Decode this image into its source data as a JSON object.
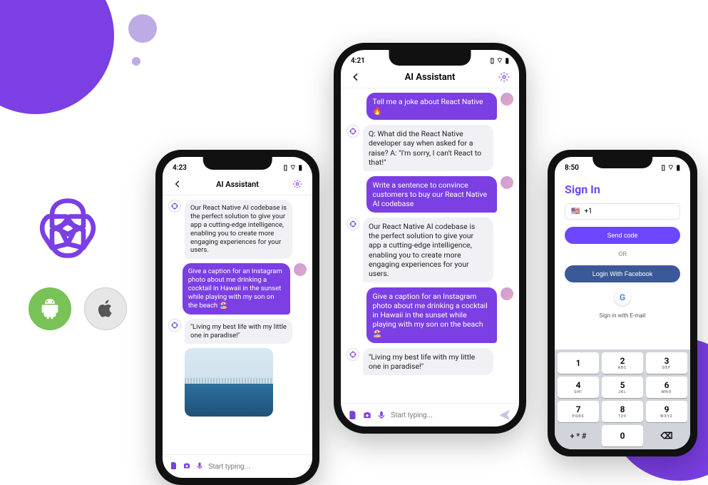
{
  "phones": {
    "chat_small": {
      "time": "4:23",
      "title": "AI Assistant",
      "messages": [
        {
          "role": "ai",
          "text": "Our React Native AI codebase is the perfect solution to give your app a cutting-edge intelligence, enabling you to create more engaging experiences for your users."
        },
        {
          "role": "user",
          "text": "Give a caption for an Instagram photo about me drinking a cocktail in Hawaii in the sunset while playing with my son on the beach 🏖️"
        },
        {
          "role": "ai",
          "text": "\"Living my best life with my little one in paradise!\""
        }
      ],
      "input_placeholder": "Start typing..."
    },
    "chat_big": {
      "time": "4:21",
      "title": "AI Assistant",
      "messages": [
        {
          "role": "user",
          "text": "Tell me a joke about React Native 🔥"
        },
        {
          "role": "ai",
          "text": "Q: What did the React Native developer say when asked for a raise? A: \"I'm sorry, I can't React to that!\""
        },
        {
          "role": "user",
          "text": "Write a sentence to convince customers to buy our React Native AI codebase"
        },
        {
          "role": "ai",
          "text": "Our React Native AI codebase is the perfect solution to give your app a cutting-edge intelligence, enabling you to create more engaging experiences for your users."
        },
        {
          "role": "user",
          "text": "Give a caption for an Instagram photo about me drinking a cocktail in Hawaii in the sunset while playing with my son on the beach 🏖️"
        },
        {
          "role": "ai",
          "text": "\"Living my best life with my little one in paradise!\""
        }
      ],
      "input_placeholder": "Start typing..."
    },
    "signin": {
      "time": "8:50",
      "title": "Sign In",
      "country_prefix": "+1",
      "send_code": "Send code",
      "or": "OR",
      "fb": "Login With Facebook",
      "email": "Sign in with E-mail",
      "keypad": [
        {
          "n": "1",
          "s": ""
        },
        {
          "n": "2",
          "s": "ABC"
        },
        {
          "n": "3",
          "s": "DEF"
        },
        {
          "n": "4",
          "s": "GHI"
        },
        {
          "n": "5",
          "s": "JKL"
        },
        {
          "n": "6",
          "s": "MNO"
        },
        {
          "n": "7",
          "s": "PQRS"
        },
        {
          "n": "8",
          "s": "TUV"
        },
        {
          "n": "9",
          "s": "WXYZ"
        },
        {
          "n": "+ * #",
          "s": "",
          "blank": true
        },
        {
          "n": "0",
          "s": ""
        },
        {
          "n": "⌫",
          "s": "",
          "del": true
        }
      ]
    }
  }
}
